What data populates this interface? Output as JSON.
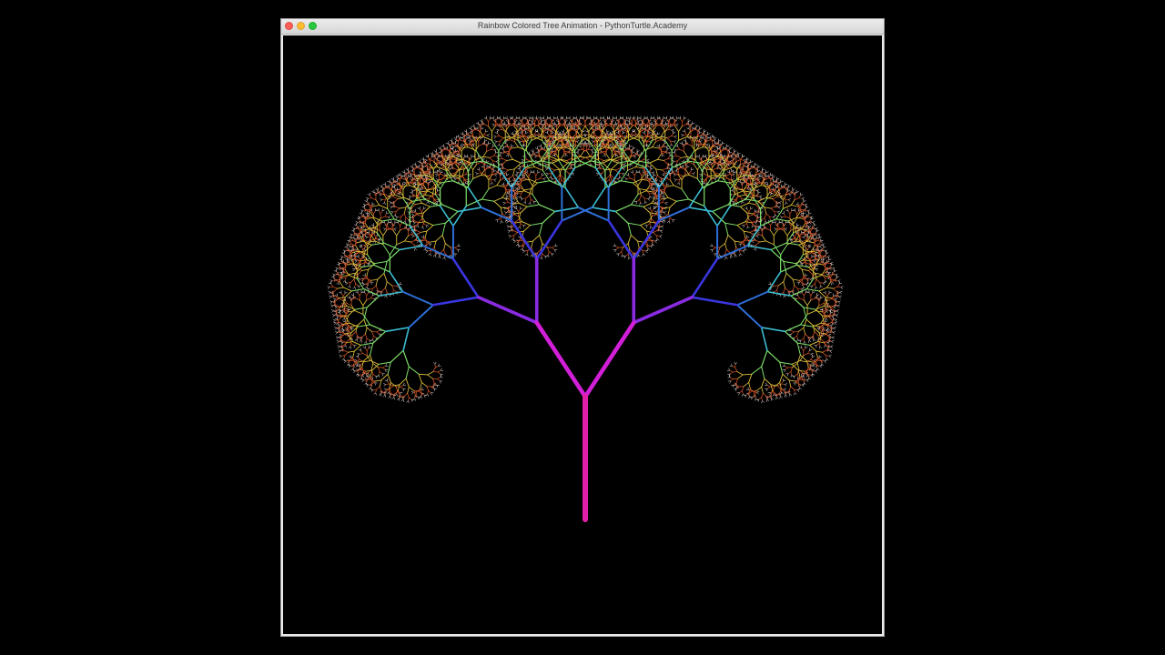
{
  "window": {
    "title": "Rainbow Colored Tree Animation - PythonTurtle.Academy"
  },
  "controls": {
    "close_icon": "close-icon",
    "minimize_icon": "minimize-icon",
    "zoom_icon": "zoom-icon"
  },
  "colors": {
    "background": "#000000",
    "trunk": "#e020a8",
    "branch_1": "#d21fd8",
    "branch_2": "#8a2be2",
    "branch_3": "#3a36e0",
    "branch_4": "#2e6fd8",
    "branch_5": "#3bbcd0",
    "leaf_1": "#7ee06a",
    "leaf_2": "#e0c23a",
    "leaf_3": "#e05a2a",
    "tip": "#f3f3f3"
  }
}
